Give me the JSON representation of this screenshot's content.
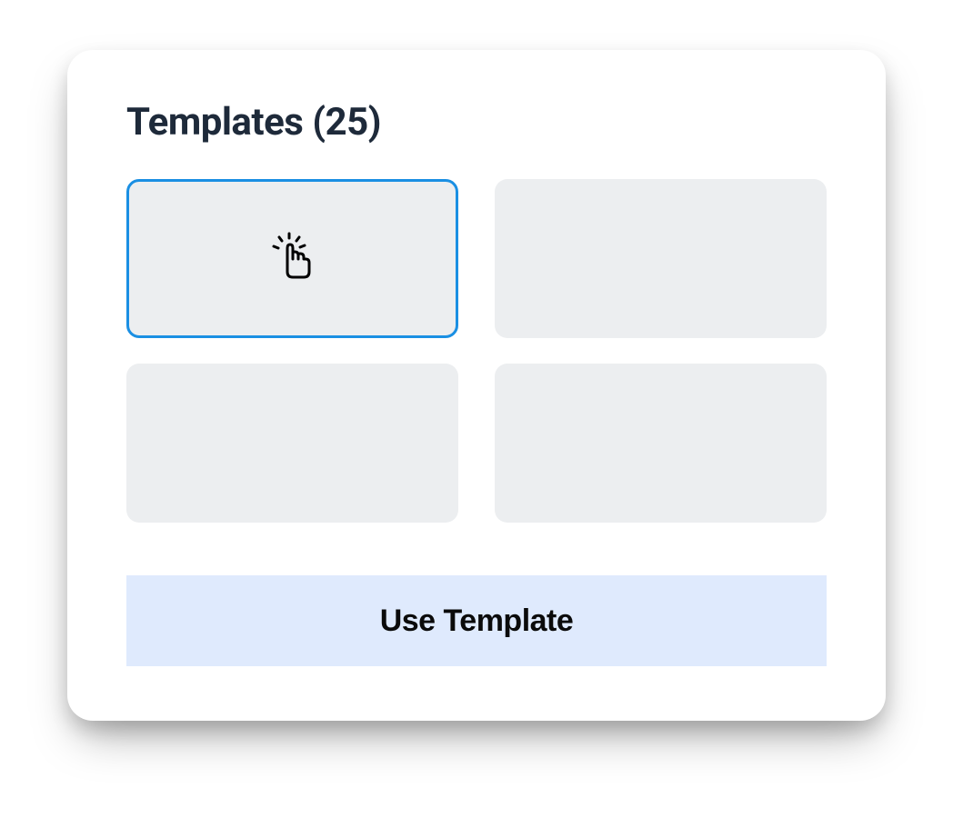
{
  "header": {
    "title": "Templates (25)"
  },
  "templates": {
    "count": 25,
    "selected_index": 0
  },
  "actions": {
    "use_template_label": "Use Template"
  },
  "icons": {
    "pointer": "pointer-click-icon"
  },
  "colors": {
    "accent": "#1a8fe3",
    "card_bg": "#eceef0",
    "button_bg": "#dfeafd",
    "title": "#1e2a3a"
  }
}
